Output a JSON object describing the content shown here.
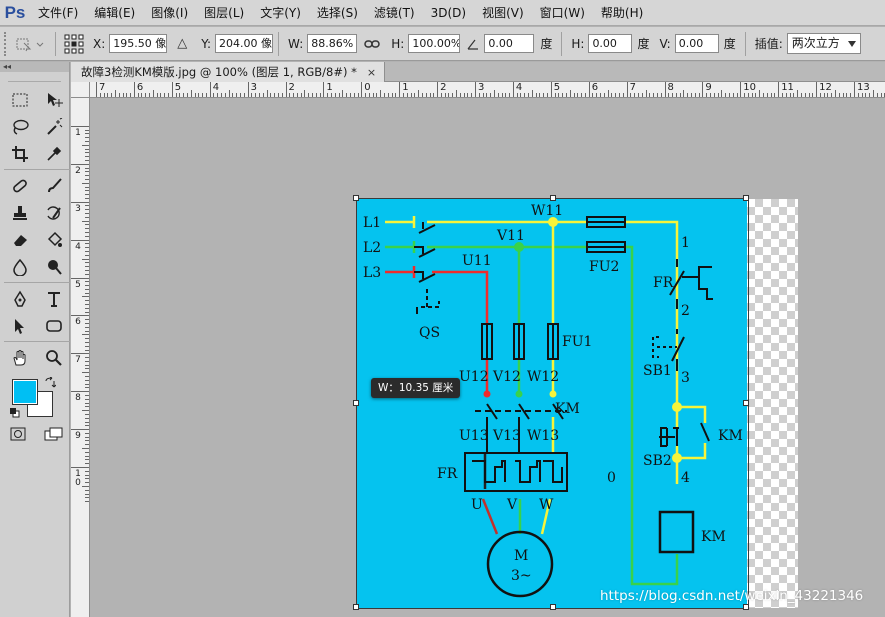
{
  "app": {
    "logo": "Ps"
  },
  "menu": [
    "文件(F)",
    "编辑(E)",
    "图像(I)",
    "图层(L)",
    "文字(Y)",
    "选择(S)",
    "滤镜(T)",
    "3D(D)",
    "视图(V)",
    "窗口(W)",
    "帮助(H)"
  ],
  "options": {
    "x_label": "X:",
    "x_value": "195.50 像",
    "delta_icon": "△",
    "y_label": "Y:",
    "y_value": "204.00 像",
    "w_label": "W:",
    "w_value": "88.86%",
    "link_icon": "chain-link-icon",
    "h_label": "H:",
    "h_value": "100.00%",
    "angle_value": "0.00",
    "angle_unit": "度",
    "hskew_label": "H:",
    "hskew_value": "0.00",
    "hskew_unit": "度",
    "vskew_label": "V:",
    "vskew_value": "0.00",
    "vskew_unit": "度",
    "interp_label": "插值:",
    "interp_value": "两次立方"
  },
  "toolbox": {
    "header": "◂◂",
    "fg_color": "#00bff3",
    "bg_color": "#ffffff"
  },
  "document": {
    "tab_title": "故障3检测KM模版.jpg @ 100% (图层 1, RGB/8#) *",
    "close": "×"
  },
  "rulers": {
    "h_labels": [
      "7",
      "6",
      "5",
      "4",
      "3",
      "2",
      "1",
      "0",
      "1",
      "2",
      "3",
      "4",
      "5",
      "6",
      "7",
      "8",
      "9",
      "10",
      "11",
      "12",
      "13"
    ],
    "v_labels": [
      "1",
      "2",
      "3",
      "4",
      "5",
      "6",
      "7",
      "8",
      "9",
      "1 0"
    ]
  },
  "tooltip": {
    "text": "W：10.35 厘米"
  },
  "watermark": "https://blog.csdn.net/weixin_43221346",
  "diagram": {
    "bg_color": "#05c3ef",
    "labels": {
      "l1": "L1",
      "l2": "L2",
      "l3": "L3",
      "w11": "W11",
      "v11": "V11",
      "u11": "U11",
      "qs": "QS",
      "fu1": "FU1",
      "fu2": "FU2",
      "u12": "U12",
      "v12": "V12",
      "w12": "W12",
      "km_contact": "KM",
      "u13": "U13",
      "v13": "V13",
      "w13": "W13",
      "fr_main": "FR",
      "u": "U",
      "v": "V",
      "w": "W",
      "motor_m": "M",
      "motor_phase": "3~",
      "n1": "1",
      "fr_ctrl": "FR",
      "n2": "2",
      "sb1": "SB1",
      "n3": "3",
      "km_aux": "KM",
      "sb2": "SB2",
      "n4": "4",
      "n0": "0",
      "km_coil": "KM"
    }
  }
}
